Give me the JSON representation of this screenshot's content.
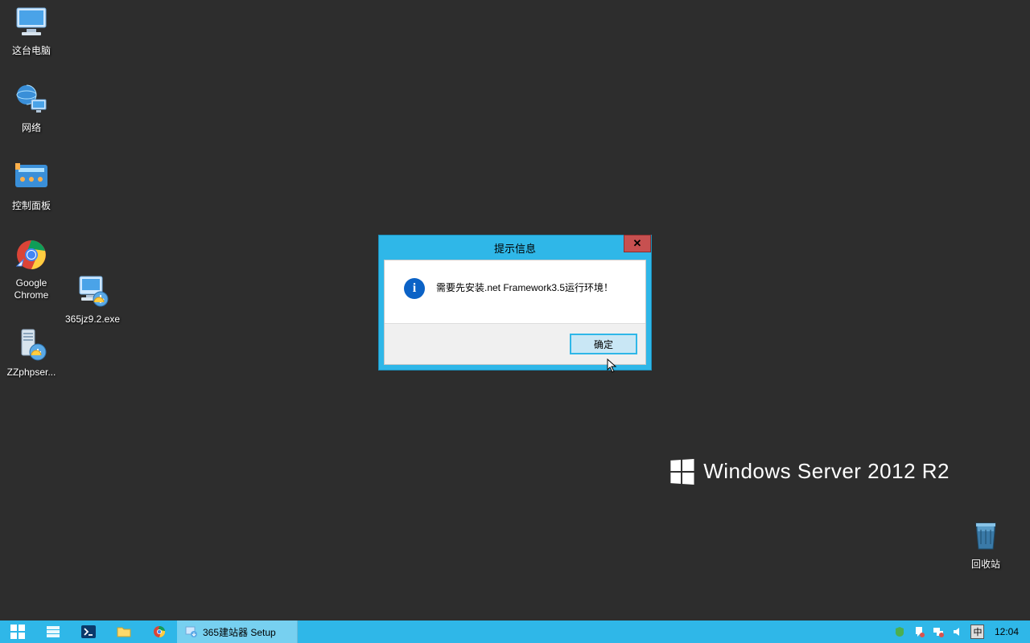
{
  "desktop_icons": {
    "this_pc": "这台电脑",
    "network": "网络",
    "control_panel": "控制面板",
    "chrome": "Google\nChrome",
    "exe_365": "365jz9.2.exe",
    "zzphp": "ZZphpser...",
    "recycle_bin": "回收站"
  },
  "watermark": "Windows Server 2012 R2",
  "dialog": {
    "title": "提示信息",
    "message": "需要先安装.net Framework3.5运行环境！",
    "ok": "确定"
  },
  "taskbar": {
    "task1": "365建站器 Setup",
    "ime": "中",
    "clock": "12:04"
  }
}
